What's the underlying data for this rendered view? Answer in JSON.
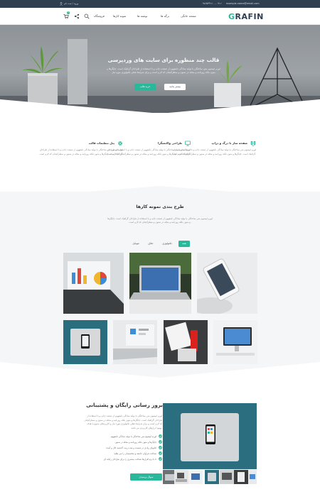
{
  "topbar": {
    "email": "example-name@email.com",
    "phone": "۰۹۸۶۵۴۳۲۱۰۰-۰۹۱۲",
    "login": "ورود / ثبت نام"
  },
  "header": {
    "logo_first": "G",
    "logo_rest": "RAFIN",
    "nav": [
      "صفحه خانگی",
      "برگه ها",
      "نوشته ها",
      "نمونه کارها",
      "فروشگاه"
    ],
    "cart_count": "0"
  },
  "hero": {
    "title": "قالب چند منظوره برای سایت های وردپرسی",
    "text": "لورم ایپسوم متن ساختگی با تولید سادگی نامفهوم از صنعت چاپ و با استفاده از طراحان گرافیک است. چاپگرها و متون بلکه روزنامه و مجله در ستون و سطرآنچنان که لازم است و برای شرایط فعلی تکنولوژی مورد نیاز",
    "btn_more": "بیشتر بدانید",
    "btn_buy": "خرید قالب"
  },
  "features": [
    {
      "title": "صفحه ساز با درگ و دراپ",
      "icon": "dropbox-icon",
      "text": "لورم ایپسوم متن ساختگی با تولید سادگی نامفهوم از صنعت چاپ و با استفاده از طراحان گرافیک است. چاپگرها و متون بلکه روزنامه و مجله در ستون و سطرآنچنان که لازم است."
    },
    {
      "title": "طراحی واکنشگرا",
      "icon": "monitor-icon",
      "text": "لورم ایپسوم متن ساختگی با تولید سادگی نامفهوم از صنعت چاپ و با استفاده از طراحان گرافیک است. چاپگرها و متون بلکه روزنامه و مجله در ستون و سطرآنچنان که لازم است."
    },
    {
      "title": "پنل تنظیمات قالب",
      "icon": "gear-icon",
      "text": "لورم ایپسوم متن ساختگی با تولید سادگی نامفهوم از صنعت چاپ و با استفاده از طراحان گرافیک است. چاپگرها و متون بلکه روزنامه و مجله در ستون و سطرآنچنان که لازم است."
    }
  ],
  "portfolio": {
    "title": "طرح بندی نمونه کارها",
    "text": "لورم ایپسوم متن ساختگی با تولید سادگی نامفهوم از صنعت چاپ و با استفاده از طراحان گرافیک است. چاپگرها و متون بلکه روزنامه و مجله در ستون و سطرآنچنان که لازم است.",
    "filters": [
      "همه",
      "تکنولوژی",
      "خلاق",
      "موبایل"
    ]
  },
  "support": {
    "title": "بروز رسانی رایگان و پشتیبانی",
    "text": "لورم ایپسوم متن ساختگی با تولید سادگی نامفهوم از صنعت چاپ و با استفاده از طراحان گرافیک است. چاپگرها و متون بلکه روزنامه و مجله در ستون و سطرآنچنان که لازم است و برای شرایط فعلی تکنولوژی مورد نیاز و کاربردهای متنوع با هدف بهبود ابزارهای کاربردی می باشد.",
    "items": [
      "لورم ایپسوم متن ساختگی با تولید سادگی نامفهوم",
      "چاپگرها و متون بلکه روزنامه و مجله در ستون",
      "کتابهای زیادی در شصت و سه درصد گذشته حال و آینده",
      "شناخت فراوان جامعه و متخصصان را می طلبد",
      "تا با نرم افزارها شناخت بیشتری را برای طراحان رایانه ای"
    ],
    "button": "سوال پرسیدن"
  },
  "colors": {
    "accent": "#29b99a",
    "dark": "#2e3f52"
  }
}
